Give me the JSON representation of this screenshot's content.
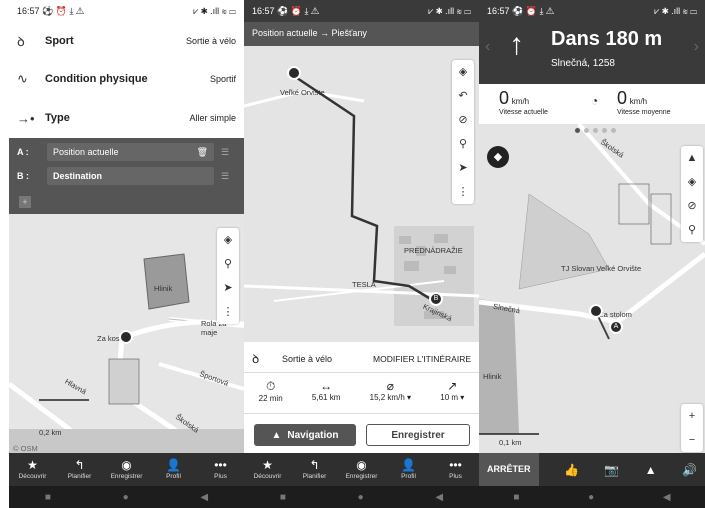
{
  "status": {
    "time": "16:57",
    "icons": "⚽ ⏰ ⤓ ⚠",
    "right": "⩗ ✱ .ıll ≋ ▭"
  },
  "p1": {
    "rows": [
      {
        "icon": "ꝺ",
        "title": "Sport",
        "value": "Sortie à vélo",
        "icon_name": "bike-icon"
      },
      {
        "icon": "∿",
        "title": "Condition physique",
        "value": "Sportif",
        "icon_name": "pulse-icon"
      },
      {
        "icon": "→•",
        "title": "Type",
        "value": "Aller simple",
        "icon_name": "arrow-dot-icon"
      }
    ],
    "wp_a_key": "A :",
    "wp_a": "Position actuelle",
    "wp_b_key": "B :",
    "wp_b": "Destination",
    "map_labels": {
      "hlinik": "Hlinik",
      "rola": "Rola za maje",
      "zako": "Za kos   om",
      "hlava": "Hlavná",
      "sport": "Športová",
      "skolska": "Školská",
      "scale": "0,2 km",
      "osm": "© OSM"
    }
  },
  "tabs": [
    {
      "icon": "★",
      "label": "Découvrir",
      "icon_name": "star-icon"
    },
    {
      "icon": "↰",
      "label": "Planifier",
      "icon_name": "plan-icon"
    },
    {
      "icon": "◉",
      "label": "Enregistrer",
      "icon_name": "record-icon"
    },
    {
      "icon": "👤",
      "label": "Profil",
      "icon_name": "profile-icon"
    },
    {
      "icon": "•••",
      "label": "Plus",
      "icon_name": "more-icon"
    }
  ],
  "nav": {
    "square": "■",
    "circle": "●",
    "back": "◀"
  },
  "p2": {
    "header": "Position actuelle → Piešťany",
    "labels": {
      "velke": "Veľké Orvište",
      "pred": "PREDNÁDRAŽIE",
      "tesla": "TESLA",
      "kraj": "Krajinská"
    },
    "sport": "Sortie à vélo",
    "modify": "MODIFIER L'ITINÉRAIRE",
    "stats": [
      {
        "icon": "⏱",
        "value": "22 min",
        "icon_name": "timer-icon"
      },
      {
        "icon": "↔",
        "value": "5,61 km",
        "icon_name": "distance-icon"
      },
      {
        "icon": "⌀",
        "value": "15,2 km/h ▾",
        "icon_name": "speed-avg-icon"
      },
      {
        "icon": "↗",
        "value": "10 m ▾",
        "icon_name": "elevation-icon"
      }
    ],
    "nav_btn": "Navigation",
    "save_btn": "Enregistrer"
  },
  "p3": {
    "arrow": "↑",
    "dist": "Dans 180 m",
    "street": "Slnečná, 1258",
    "speed_cur": "0",
    "unit": "km/h",
    "cur_label": "Vitesse actuelle",
    "speed_avg": "0",
    "avg_label": "Vitesse moyenne",
    "labels": {
      "skolska": "Školská",
      "sklovan": "TJ Slovan\nVeľké Orvište",
      "slnecna": "Slnečná",
      "hlinik": "Hlinik",
      "zastolom": "Za stolom",
      "scale": "0,1 km"
    },
    "stop": "ARRÊTER"
  }
}
